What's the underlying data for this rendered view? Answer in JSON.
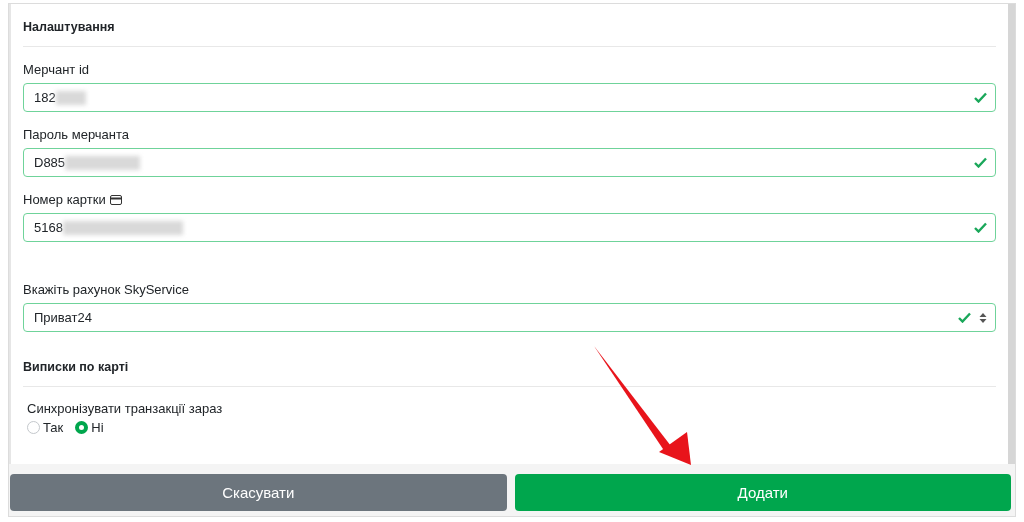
{
  "settings": {
    "title": "Налаштування",
    "fields": [
      {
        "kind": "input",
        "label": "Мерчант id",
        "card_icon": false,
        "value": "182",
        "redacted": true,
        "valid": true
      },
      {
        "kind": "input",
        "label": "Пароль мерчанта",
        "card_icon": false,
        "value": "D885",
        "redacted": true,
        "valid": true
      },
      {
        "kind": "input",
        "label": "Номер картки",
        "card_icon": true,
        "value": "5168",
        "redacted": true,
        "valid": true
      },
      {
        "kind": "select",
        "label": "Вкажіть рахунок SkyService",
        "card_icon": false,
        "value": "Приват24",
        "redacted": false,
        "valid": true
      }
    ]
  },
  "statements": {
    "title": "Виписки по карті",
    "sync": {
      "label": "Синхронізувати транзакції зараз",
      "options": [
        {
          "label": "Так",
          "selected": false
        },
        {
          "label": "Ні",
          "selected": true
        }
      ]
    }
  },
  "buttons": [
    {
      "kind": "secondary",
      "label": "Скасувати"
    },
    {
      "kind": "primary",
      "label": "Додати"
    }
  ],
  "annotation": {
    "kind": "arrow"
  }
}
